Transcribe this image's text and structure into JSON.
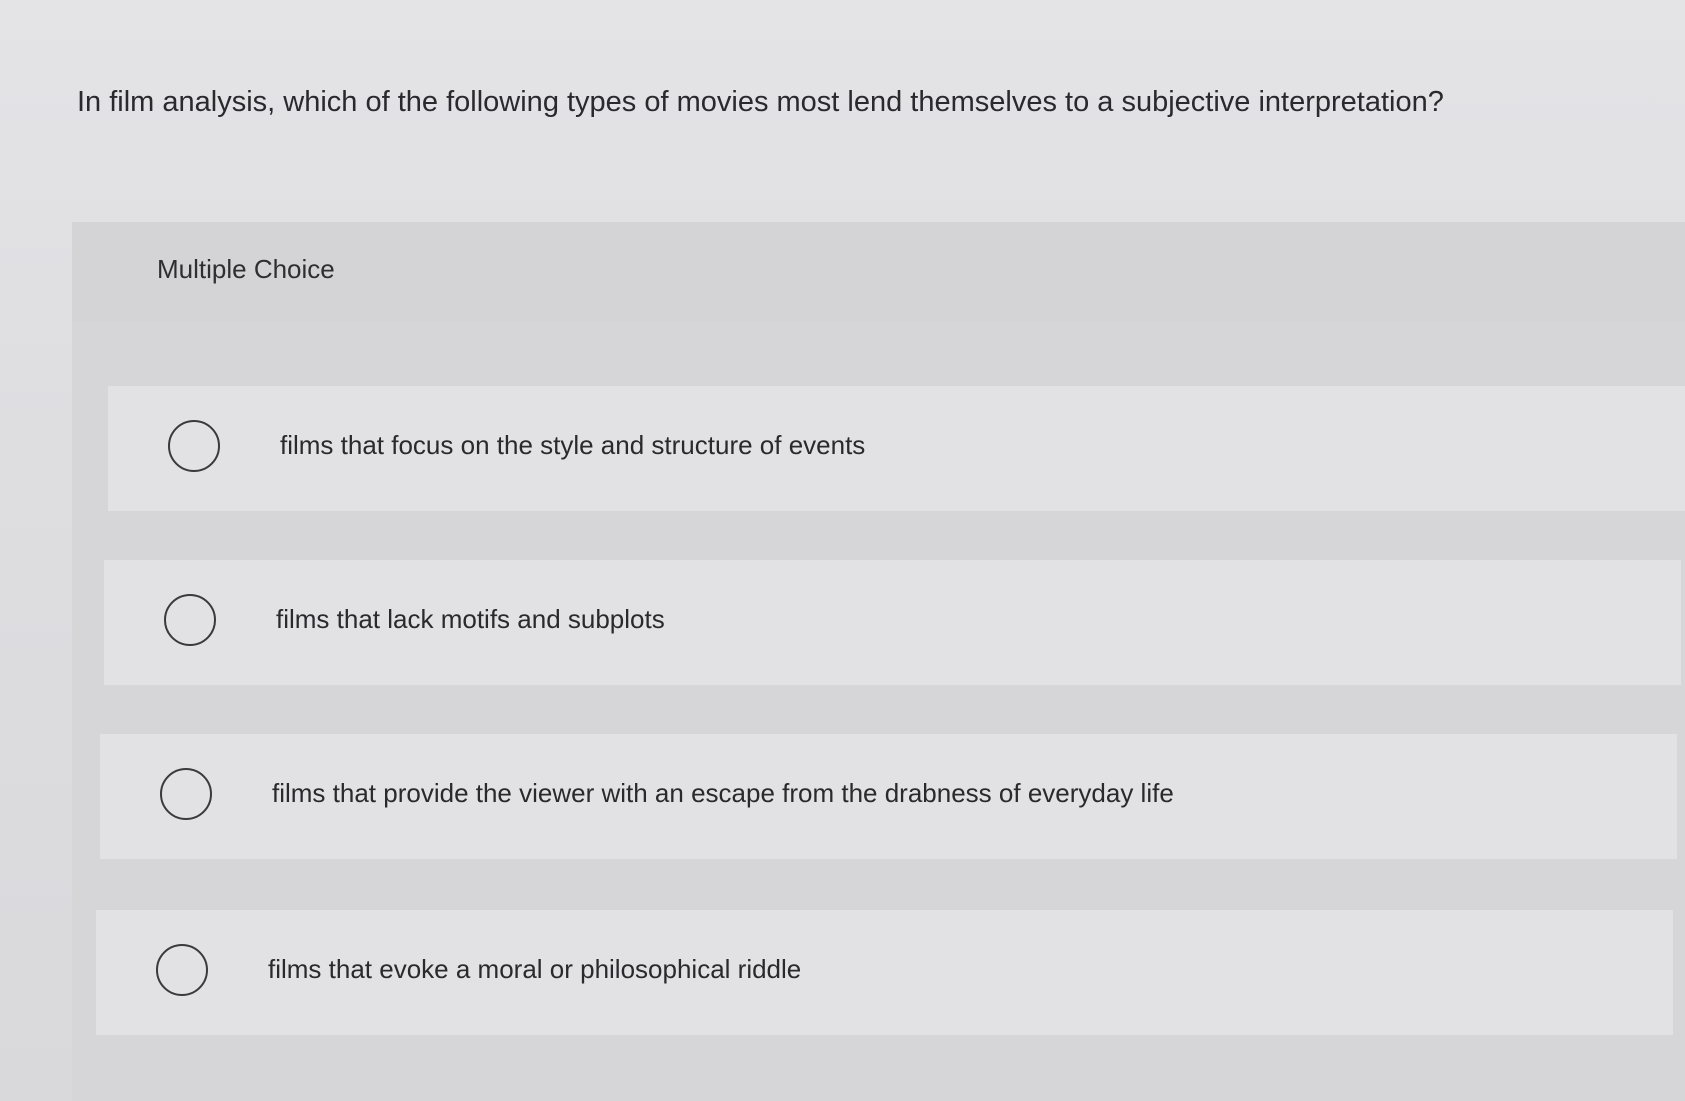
{
  "question": {
    "text": "In film analysis, which of the following types of movies most lend themselves to a subjective interpretation?"
  },
  "multiple_choice": {
    "label": "Multiple Choice",
    "options": [
      {
        "text": "films that focus on the style and structure of events",
        "selected": false
      },
      {
        "text": "films that lack motifs and subplots",
        "selected": false
      },
      {
        "text": "films that provide the viewer with an escape from the drabness of everyday life",
        "selected": false
      },
      {
        "text": "films that evoke a moral or philosophical riddle",
        "selected": false
      }
    ]
  }
}
